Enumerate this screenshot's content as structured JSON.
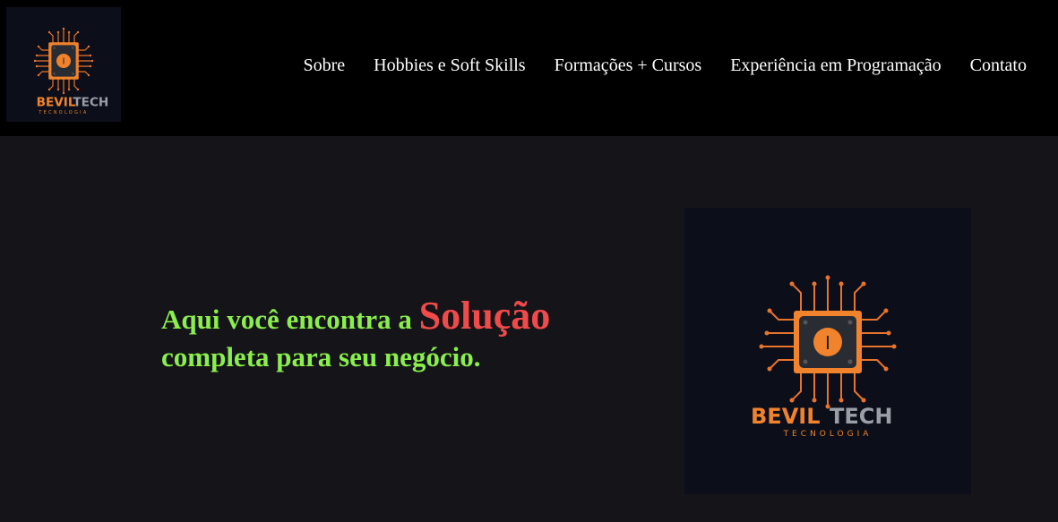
{
  "brand": {
    "logo_word_orange": "BEVIL",
    "logo_word_gray": "TECH",
    "logo_subtitle": "TECNOLOGIA",
    "logo_chip_glyph": "I"
  },
  "nav": {
    "items": [
      {
        "label": "Sobre"
      },
      {
        "label": "Hobbies e Soft Skills"
      },
      {
        "label": "Formações + Cursos"
      },
      {
        "label": "Experiência em Programação"
      },
      {
        "label": "Contato"
      }
    ]
  },
  "hero": {
    "line1_prefix": "Aqui você encontra a ",
    "line1_highlight": "Solução",
    "line2": "completa para seu negócio."
  },
  "colors": {
    "header_bg": "#000000",
    "page_bg": "#151419",
    "hero_text": "#8aee4c",
    "hero_highlight": "#f04a4a",
    "brand_orange": "#f0832c",
    "brand_gray": "#9a9ea6"
  }
}
